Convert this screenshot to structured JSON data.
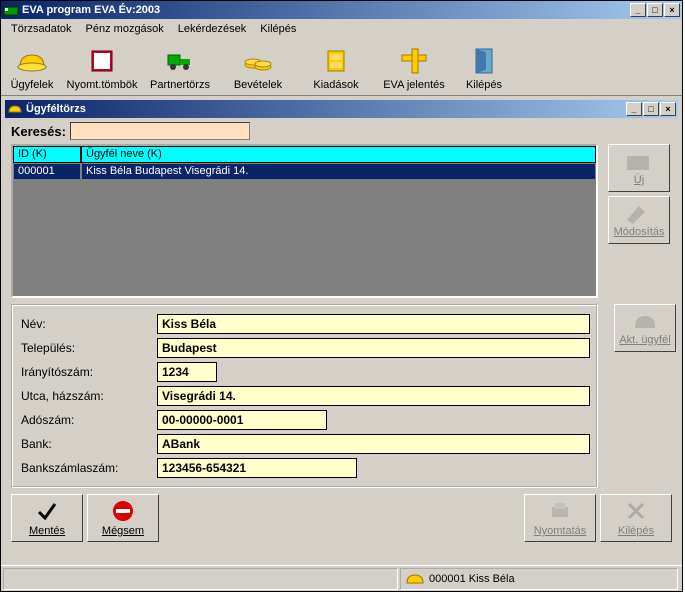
{
  "app": {
    "title": "EVA program EVA Év:2003"
  },
  "menu": {
    "items": [
      "Törzsadatok",
      "Pénz mozgások",
      "Lekérdezések",
      "Kilépés"
    ]
  },
  "toolbar": {
    "items": [
      {
        "label": "Ügyfelek"
      },
      {
        "label": "Nyomt.tömbök"
      },
      {
        "label": "Partnertörzs"
      },
      {
        "label": "Bevételek"
      },
      {
        "label": "Kiadások"
      },
      {
        "label": "EVA jelentés"
      },
      {
        "label": "Kilépés"
      }
    ]
  },
  "child": {
    "title": "Ügyféltörzs",
    "search_label": "Keresés:",
    "search_value": "",
    "table": {
      "headers": [
        "ID (K)",
        "Ügyfél neve (K)"
      ],
      "rows": [
        {
          "id": "000001",
          "name": "Kiss Béla Budapest Visegrádi 14."
        }
      ]
    },
    "side_buttons": {
      "new": "Új",
      "edit": "Módosítás",
      "current": "Akt. ügyfél"
    },
    "form": {
      "labels": {
        "name": "Név:",
        "city": "Település:",
        "zip": "Irányítószám:",
        "street": "Utca, házszám:",
        "tax": "Adószám:",
        "bank": "Bank:",
        "account": "Bankszámlaszám:"
      },
      "values": {
        "name": "Kiss Béla",
        "city": "Budapest",
        "zip": "1234",
        "street": "Visegrádi 14.",
        "tax": "00-00000-0001",
        "bank": "ABank",
        "account": "123456-654321"
      }
    },
    "bottom_buttons": {
      "save": "Mentés",
      "cancel": "Mégsem",
      "print": "Nyomtatás",
      "exit": "Kilépés"
    }
  },
  "status": {
    "text": "000001 Kiss Béla"
  }
}
